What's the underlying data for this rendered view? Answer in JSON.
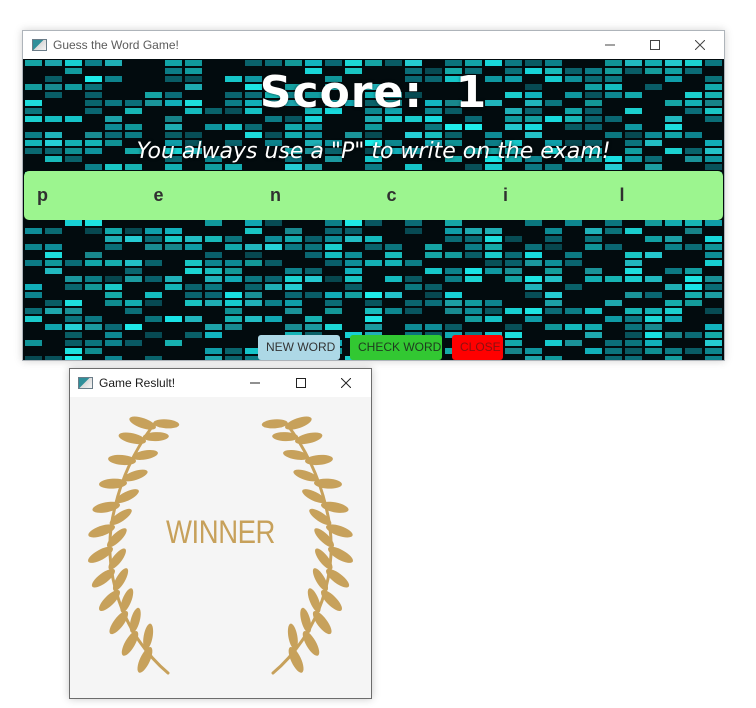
{
  "main_window": {
    "title": "Guess the Word Game!",
    "controls": [
      "minimize-icon",
      "maximize-icon",
      "close-icon"
    ]
  },
  "game": {
    "score_text": "Score:  1",
    "hint": "You always use a \"P\" to write on the exam!",
    "letters": [
      "p",
      "e",
      "n",
      "c",
      "i",
      "l"
    ],
    "background": "cyan-equalizer-pattern",
    "colors": {
      "letters_bg": "#9cf58f",
      "equalizer": "#19e3e6",
      "new_word": "#add8e6",
      "check_word": "#32c832",
      "close": "#ff0000"
    },
    "buttons": {
      "new_word": "NEW WORD",
      "check_word": "CHECK WORD",
      "close": "CLOSE"
    }
  },
  "result_window": {
    "title": "Game Reslult!",
    "winner_text": "WINNER",
    "image": "laurel-wreath",
    "colors": {
      "gold": "#c7a15b",
      "background": "#f5f5f5"
    }
  }
}
